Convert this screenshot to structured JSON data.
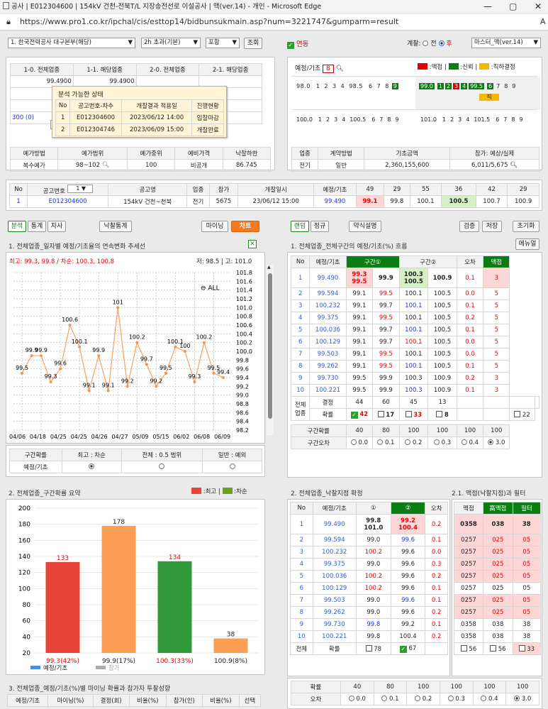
{
  "window": {
    "title": "공사 | E012304600 | 154kV 건천-전북T/L 지장송전선로 이설공사 | 맥(ver.14) - 개인 - Microsoft Edge",
    "min": "—",
    "max": "▢",
    "close": "✕"
  },
  "address": {
    "url": "https://www.pro1.co.kr/ipchal/cis/esttop14/bidbunsukmain.asp?num=3221747&gumparm=result",
    "lock_icon": "lock-icon",
    "ext": "A"
  },
  "toolbar": {
    "org": "1. 한국전력공사 대구본부(해당)",
    "period": "2h 초과(기본)",
    "include": "포함",
    "search": "조회",
    "linked": "연동",
    "scope_label": "계찰:",
    "opt_before": "전",
    "opt_after": "후",
    "master": "마스터_맥(ver.14)"
  },
  "top_left": {
    "headers": [
      "1-0. 전체업종",
      "1-1. 해당업종",
      "2-0. 전체업종",
      "2-1. 해당업종"
    ],
    "rows": [
      [
        "99.4900",
        "99.4900",
        "",
        ""
      ],
      [
        "99",
        "",
        "",
        ""
      ],
      [
        "100",
        "",
        "",
        ""
      ]
    ],
    "row4_left": "300 (0)",
    "row4_box": "0",
    "popup": {
      "title": "분석 가능한 상태",
      "headers": [
        "No",
        "공고번호-차수",
        "개찰결과 적용일",
        "진행현황"
      ],
      "rows": [
        [
          "1",
          "E012304600",
          "2023/06/12 14:00",
          "입찰마감"
        ],
        [
          "2",
          "E012304746",
          "2023/06/09 15:00",
          "개찰완료"
        ]
      ]
    }
  },
  "method": {
    "headers": [
      "예가방법",
      "예가범위",
      "예가중위",
      "예비가격",
      "낙찰하한"
    ],
    "values": [
      "복수예가",
      "98~102",
      "100",
      "비공개",
      "86.745"
    ]
  },
  "yegi_strip": {
    "label": "예정/기초",
    "count": "8",
    "legend": [
      {
        "text": ":맥점",
        "color": "#e00000"
      },
      {
        "text": ":신뢰",
        "color": "#0b7d14"
      },
      {
        "text": ":직하결정",
        "color": "#f5b800"
      }
    ],
    "row1a": [
      "98.0",
      "1",
      "2",
      "3",
      "4",
      "98.5",
      "6",
      "7",
      "8",
      "9"
    ],
    "row1b": [
      "99.0",
      "1",
      "2",
      "3",
      "4",
      "99.5",
      "6",
      "7",
      "8",
      "9"
    ],
    "zik": "직",
    "row2a": [
      "100.0",
      "1",
      "2",
      "3",
      "4",
      "100.5",
      "6",
      "7",
      "8",
      "9"
    ],
    "row2b": [
      "101.0",
      "1",
      "2",
      "3",
      "4",
      "101.5",
      "6",
      "7",
      "8",
      "9"
    ]
  },
  "industry": {
    "headers": [
      "업종",
      "계약방법",
      "기초금액",
      "참가: 예상/실제"
    ],
    "values": [
      "전기",
      "일반",
      "2,360,155,600",
      "6,011/5,675"
    ]
  },
  "notice": {
    "headers": [
      "No",
      "공고번호",
      "공고명",
      "업종",
      "참가",
      "개찰일시",
      "예정/기초",
      "49",
      "29",
      "55",
      "36",
      "42",
      "29"
    ],
    "select": "1",
    "row": [
      "1",
      "E012304600",
      "154kV 건천~천북",
      "전기",
      "5675",
      "23/06/12 15:00",
      "99.490",
      "99.1",
      "99.8",
      "100.1",
      "100.5",
      "100.7",
      "100.9"
    ]
  },
  "left_tabs": {
    "analysis": "분석",
    "stats": "통계",
    "self": "자사",
    "win_stats": "낙찰통계",
    "mining": "마이닝",
    "chart": "차트"
  },
  "right_tabs": {
    "random": "랜덤",
    "regular": "정규",
    "legend": "약식설명",
    "verify": "검증",
    "save": "저장",
    "reset": "초기화",
    "manual": "메뉴얼"
  },
  "chart1": {
    "title": "1. 전체업종_일자별 예정/기초율의 연속변화 추세선",
    "max_label": "최고: 99.3, 99.8 / 차순: 100.3, 100.8",
    "low_high": "저: 98.5 | 고: 101.0",
    "zoom": "ALL",
    "x": [
      "04/06",
      "04/18",
      "04/25",
      "04/25",
      "04/26",
      "04/27",
      "05/09",
      "05/15",
      "06/02",
      "06/08",
      "06/09"
    ],
    "yticks": [
      "101.8",
      "101.6",
      "101.4",
      "101.2",
      "101.0",
      "100.8",
      "100.6",
      "100.4",
      "100.2",
      "100.0",
      "99.8",
      "99.6",
      "99.4",
      "99.2",
      "99.0",
      "98.8",
      "98.6",
      "98.4",
      "98.2"
    ],
    "labels": [
      "99.5",
      "99.9",
      "99.9",
      "99.3",
      "99.6",
      "100.6",
      "100.1",
      "99.1",
      "99.9",
      "99.1",
      "101",
      "99.2",
      "100.2",
      "99.7",
      "99.2",
      "99.5",
      "100.1",
      "100",
      "99.3",
      "100.2",
      "99.5",
      "99.4"
    ]
  },
  "chart_data": [
    {
      "type": "line",
      "title": "1. 전체업종_일자별 예정/기초율의 연속변화 추세선",
      "categories": [
        "04/06",
        "04/18",
        "04/25",
        "04/25",
        "04/26",
        "04/27",
        "05/09",
        "05/15",
        "06/02",
        "06/08",
        "06/09"
      ],
      "series": [
        {
          "values": [
            99.5,
            99.9,
            99.9,
            99.3,
            99.6,
            100.6,
            100.1,
            99.1,
            99.9,
            99.1,
            101.0,
            99.2,
            100.2,
            99.7,
            99.2,
            99.5,
            100.1,
            100.0,
            99.3,
            100.2,
            99.5,
            99.4
          ]
        }
      ],
      "ylim": [
        98.2,
        101.8
      ]
    },
    {
      "type": "bar",
      "title": "2. 전체업종_구간확률 요약",
      "categories": [
        "99.3(42%)",
        "99.9(17%)",
        "100.3(33%)",
        "100.9(8%)"
      ],
      "values": [
        133,
        178,
        134,
        38
      ],
      "ylim": [
        20,
        200
      ],
      "yticks": [
        "200",
        "180",
        "160",
        "140",
        "120",
        "100",
        "80",
        "60",
        "40",
        "20"
      ],
      "colors": [
        "#e8443a",
        "#fa9e54",
        "#329a3a",
        "#fa9e54"
      ],
      "legend": [
        {
          "text": "예정/기초",
          "color": "#4a90e2"
        },
        {
          "text": "참가",
          "color": "#aaaaaa"
        }
      ],
      "top_legend": [
        {
          "text": ":최고",
          "color": "#e8443a"
        },
        {
          "text": ":차순",
          "color": "#6aa02a"
        }
      ]
    }
  ],
  "interval_prob": {
    "headers": [
      "구간확률",
      "최고 : 차순",
      "전체 : 0.5 범위",
      "일반 : 예외"
    ],
    "label": "예정/기초"
  },
  "bar_title": "2. 전체업종_구간확률 요약",
  "mining_title": "3. 전체업종_예정/기초(%)별 마이닝 확률과 참가자 투찰성향",
  "mining_headers": [
    "예정/기초",
    "마이닝(%)",
    "결정(회)",
    "비율(%)",
    "참가(인)",
    "비율(%)",
    "선택"
  ],
  "right1": {
    "title": "1. 전체업종_전체구간의 예정/기초(%) 흐름",
    "headers": [
      "No",
      "예정/기초",
      "구간①",
      "구간②",
      "오차",
      "맥점"
    ],
    "rows": [
      [
        "1",
        "99.490",
        "99.3\n99.5",
        "99.9",
        "100.3\n100.5",
        "100.9",
        "0.1",
        "3"
      ],
      [
        "2",
        "99.594",
        "99.1",
        "99.5",
        "100.1",
        "100.5",
        "0.0",
        "5"
      ],
      [
        "3",
        "100.232",
        "99.1",
        "99.7",
        "100.1",
        "100.5",
        "0.1",
        "5"
      ],
      [
        "4",
        "99.375",
        "99.1",
        "99.5",
        "100.1",
        "100.5",
        "0.2",
        "5"
      ],
      [
        "5",
        "100.036",
        "99.1",
        "99.7",
        "100.1",
        "100.5",
        "0.1",
        "5"
      ],
      [
        "6",
        "100.129",
        "99.1",
        "99.7",
        "100.1",
        "100.5",
        "0.0",
        "5"
      ],
      [
        "7",
        "99.503",
        "99.1",
        "99.5",
        "100.1",
        "100.5",
        "0.0",
        "5"
      ],
      [
        "8",
        "99.262",
        "99.1",
        "99.5",
        "100.1",
        "100.5",
        "0.1",
        "5"
      ],
      [
        "9",
        "99.730",
        "99.5",
        "99.9",
        "100.3",
        "100.9",
        "0.2",
        "3"
      ],
      [
        "10",
        "100.221",
        "99.5",
        "99.9",
        "100.3",
        "100.9",
        "0.1",
        "3"
      ]
    ],
    "all_label": "전체\n업종",
    "decide": "결정",
    "decide_vals": [
      "44",
      "60",
      "45",
      "13"
    ],
    "prob": "확률",
    "prob_vals": [
      "42",
      "17",
      "33",
      "8",
      "22"
    ],
    "iv_prob": "구간확률",
    "iv_vals": [
      "40",
      "80",
      "100",
      "100",
      "100",
      "100"
    ],
    "iv_err": "구간오차",
    "err_vals": [
      "0.0",
      "0.1",
      "0.2",
      "0.3",
      "0.4",
      "3.0"
    ]
  },
  "right2": {
    "title": "2. 전체업종_낙찰지점 확정",
    "headers": [
      "No",
      "예정/기초",
      "①",
      "②",
      "오차"
    ],
    "rows": [
      [
        "1",
        "99.490",
        "99.8\n101.0",
        "99.2\n100.4",
        "0.2"
      ],
      [
        "2",
        "99.594",
        "99.0",
        "99.6",
        "0.1"
      ],
      [
        "3",
        "100.232",
        "100.2",
        "99.6",
        "0.0"
      ],
      [
        "4",
        "99.375",
        "99.0",
        "99.6",
        "0.3"
      ],
      [
        "5",
        "100.036",
        "100.2",
        "99.6",
        "0.2"
      ],
      [
        "6",
        "100.129",
        "100.2",
        "99.6",
        "0.1"
      ],
      [
        "7",
        "99.503",
        "99.0",
        "99.6",
        "0.1"
      ],
      [
        "8",
        "99.262",
        "99.0",
        "99.6",
        "0.2"
      ],
      [
        "9",
        "99.730",
        "99.8",
        "99.2",
        "0.1"
      ],
      [
        "10",
        "100.221",
        "99.8",
        "100.4",
        "0.2"
      ]
    ],
    "all": "전체",
    "prob": "확률",
    "p1": "78",
    "p2": "67"
  },
  "right3": {
    "title": "2.1. 맥점(낙찰지점)과 필터",
    "headers": [
      "맥점",
      "高맥점",
      "필터"
    ],
    "rows": [
      [
        "0358",
        "038",
        "38"
      ],
      [
        "0257",
        "025",
        "05"
      ],
      [
        "0257",
        "025",
        "05"
      ],
      [
        "0257",
        "025",
        "05"
      ],
      [
        "0257",
        "025",
        "05"
      ],
      [
        "0257",
        "025",
        "05"
      ],
      [
        "0257",
        "025",
        "05"
      ],
      [
        "0257",
        "025",
        "05"
      ],
      [
        "0358",
        "038",
        "38"
      ],
      [
        "0358",
        "038",
        "38"
      ]
    ],
    "p": [
      "56",
      "56",
      "33"
    ]
  },
  "bottom_right": {
    "prob": "확률",
    "vals": [
      "40",
      "80",
      "100",
      "100",
      "100",
      "100"
    ],
    "err": "오차",
    "err_vals": [
      "0.0",
      "0.1",
      "0.2",
      "0.3",
      "0.4",
      "3.0"
    ]
  }
}
